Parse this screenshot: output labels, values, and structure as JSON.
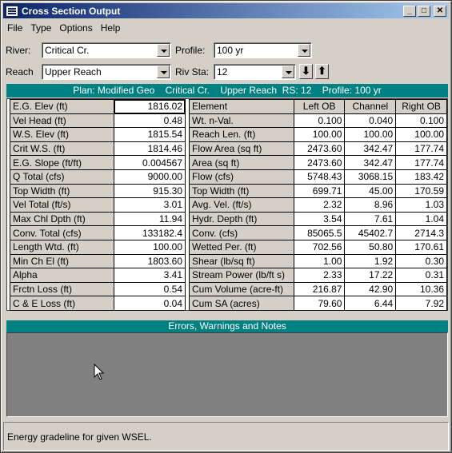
{
  "window": {
    "title": "Cross Section Output",
    "buttons": {
      "minimize": "_",
      "maximize": "□",
      "close": "✕"
    }
  },
  "menu": [
    "File",
    "Type",
    "Options",
    "Help"
  ],
  "selectors": {
    "river_label": "River:",
    "river_value": "Critical Cr.",
    "reach_label": "Reach",
    "reach_value": "Upper Reach",
    "profile_label": "Profile:",
    "profile_value": "100 yr",
    "rivsta_label": "Riv Sta:",
    "rivsta_value": "12"
  },
  "plan_bar": "Plan: Modified Geo    Critical Cr.    Upper Reach  RS: 12    Profile: 100 yr",
  "left_table": [
    {
      "label": "E.G. Elev (ft)",
      "value": "1816.02"
    },
    {
      "label": "Vel Head (ft)",
      "value": "0.48"
    },
    {
      "label": "W.S. Elev (ft)",
      "value": "1815.54"
    },
    {
      "label": "Crit W.S. (ft)",
      "value": "1814.46"
    },
    {
      "label": "E.G. Slope (ft/ft)",
      "value": "0.004567"
    },
    {
      "label": "Q Total (cfs)",
      "value": "9000.00"
    },
    {
      "label": "Top Width (ft)",
      "value": "915.30"
    },
    {
      "label": "Vel Total (ft/s)",
      "value": "3.01"
    },
    {
      "label": "Max Chl Dpth (ft)",
      "value": "11.94"
    },
    {
      "label": "Conv. Total (cfs)",
      "value": "133182.4"
    },
    {
      "label": "Length Wtd. (ft)",
      "value": "100.00"
    },
    {
      "label": "Min Ch El (ft)",
      "value": "1803.60"
    },
    {
      "label": "Alpha",
      "value": "3.41"
    },
    {
      "label": "Frctn Loss (ft)",
      "value": "0.54"
    },
    {
      "label": "C & E Loss (ft)",
      "value": "0.04"
    }
  ],
  "right_table": {
    "headers": [
      "Element",
      "Left OB",
      "Channel",
      "Right OB"
    ],
    "rows": [
      {
        "label": "Wt. n-Val.",
        "left": "0.100",
        "channel": "0.040",
        "right": "0.100"
      },
      {
        "label": "Reach Len. (ft)",
        "left": "100.00",
        "channel": "100.00",
        "right": "100.00"
      },
      {
        "label": "Flow Area (sq ft)",
        "left": "2473.60",
        "channel": "342.47",
        "right": "177.74"
      },
      {
        "label": "Area (sq ft)",
        "left": "2473.60",
        "channel": "342.47",
        "right": "177.74"
      },
      {
        "label": "Flow (cfs)",
        "left": "5748.43",
        "channel": "3068.15",
        "right": "183.42"
      },
      {
        "label": "Top Width (ft)",
        "left": "699.71",
        "channel": "45.00",
        "right": "170.59"
      },
      {
        "label": "Avg. Vel. (ft/s)",
        "left": "2.32",
        "channel": "8.96",
        "right": "1.03"
      },
      {
        "label": "Hydr. Depth (ft)",
        "left": "3.54",
        "channel": "7.61",
        "right": "1.04"
      },
      {
        "label": "Conv. (cfs)",
        "left": "85065.5",
        "channel": "45402.7",
        "right": "2714.3"
      },
      {
        "label": "Wetted Per. (ft)",
        "left": "702.56",
        "channel": "50.80",
        "right": "170.61"
      },
      {
        "label": "Shear (lb/sq ft)",
        "left": "1.00",
        "channel": "1.92",
        "right": "0.30"
      },
      {
        "label": "Stream Power (lb/ft s)",
        "left": "2.33",
        "channel": "17.22",
        "right": "0.31"
      },
      {
        "label": "Cum Volume (acre-ft)",
        "left": "216.87",
        "channel": "42.90",
        "right": "10.36"
      },
      {
        "label": "Cum SA (acres)",
        "left": "79.60",
        "channel": "6.44",
        "right": "7.92"
      }
    ]
  },
  "errors_title": "Errors, Warnings and Notes",
  "status_text": "Energy gradeline for given WSEL."
}
